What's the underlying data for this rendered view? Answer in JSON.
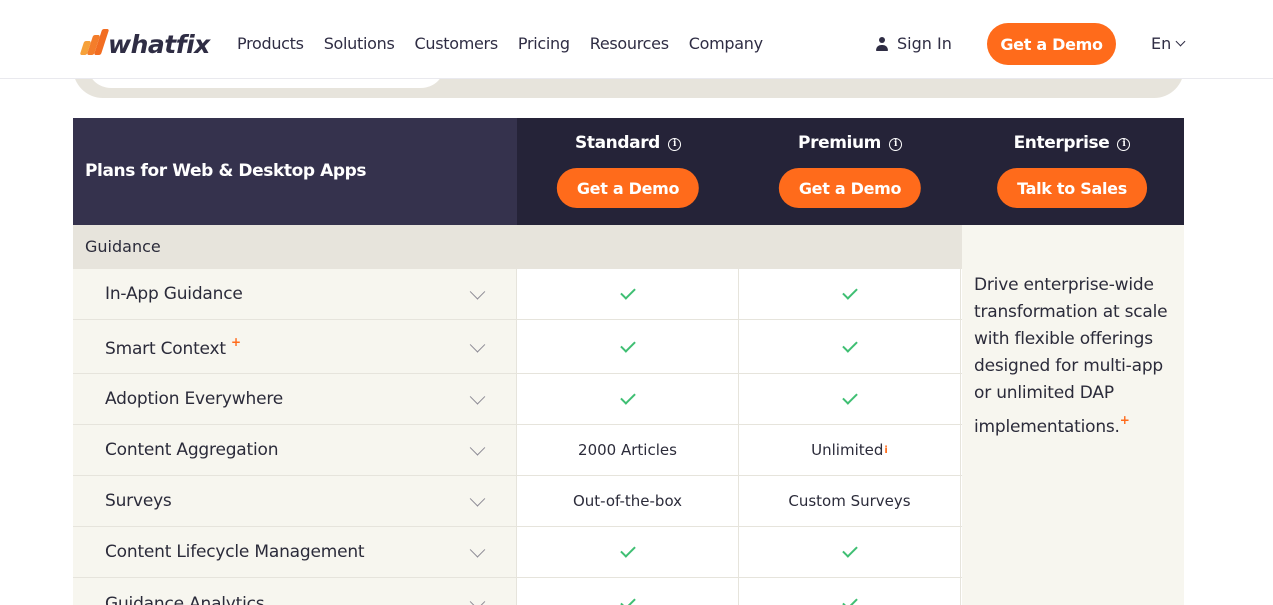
{
  "header": {
    "logo_text": "whatfix",
    "nav": [
      "Products",
      "Solutions",
      "Customers",
      "Pricing",
      "Resources",
      "Company"
    ],
    "sign_in": "Sign In",
    "cta": "Get a Demo",
    "language": "En"
  },
  "table": {
    "title": "Plans for Web & Desktop Apps",
    "plans": [
      {
        "name": "Standard",
        "button": "Get a Demo"
      },
      {
        "name": "Premium",
        "button": "Get a Demo"
      },
      {
        "name": "Enterprise",
        "button": "Talk to Sales"
      }
    ],
    "section": "Guidance",
    "enterprise_text": "Drive enterprise-wide transformation at scale with flexible offerings designed for multi-app or unlimited DAP implementations.",
    "enterprise_plus": "+",
    "rows": [
      {
        "label": "In-App Guidance",
        "standard": "check",
        "premium": "check"
      },
      {
        "label": "Smart Context",
        "plus": "+",
        "standard": "check",
        "premium": "check"
      },
      {
        "label": "Adoption Everywhere",
        "standard": "check",
        "premium": "check"
      },
      {
        "label": "Content Aggregation",
        "standard": "2000 Articles",
        "premium": "Unlimited",
        "premium_info": "i"
      },
      {
        "label": "Surveys",
        "standard": "Out-of-the-box",
        "premium": "Custom Surveys"
      },
      {
        "label": "Content Lifecycle Management",
        "standard": "check",
        "premium": "check"
      },
      {
        "label": "Guidance Analytics",
        "standard": "check",
        "premium": "check"
      }
    ]
  },
  "colors": {
    "accent": "#ff6b1b",
    "header_dark": "#252338",
    "header_left": "#35324d",
    "check": "#3fbf73",
    "section_bg": "#e7e4dc",
    "row_bg": "#f7f6ef"
  }
}
